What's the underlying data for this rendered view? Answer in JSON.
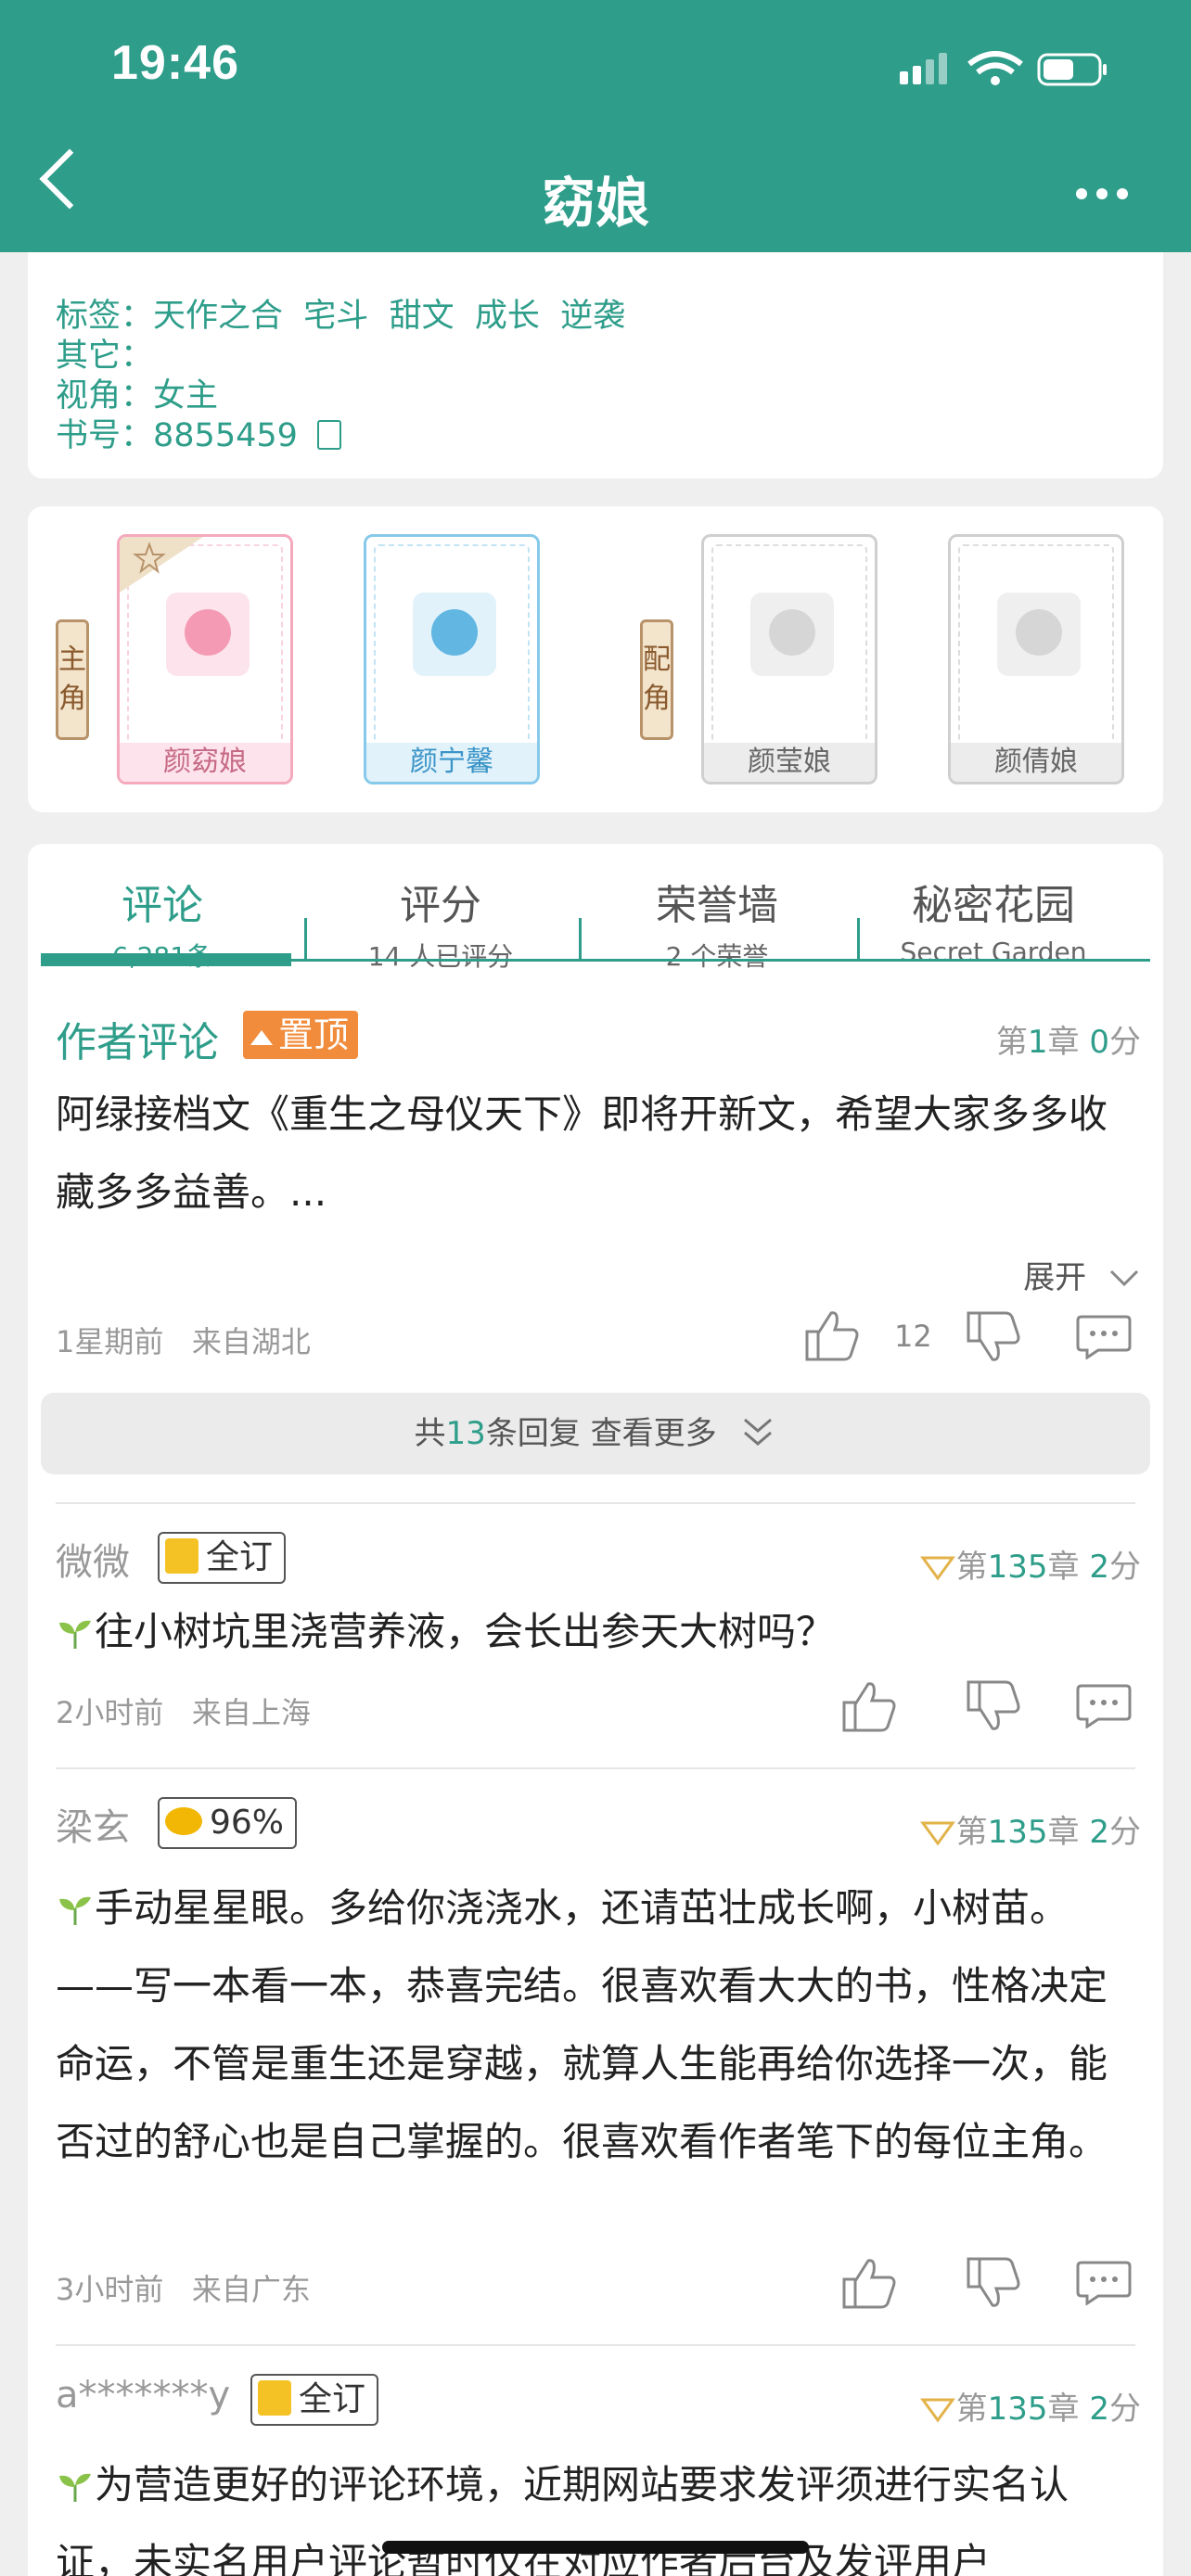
{
  "status_bar": {
    "time": "19:46"
  },
  "nav": {
    "title": "窈娘"
  },
  "info": {
    "tags_label": "标签：",
    "tags": [
      "天作之合",
      "宅斗",
      "甜文",
      "成长",
      "逆袭"
    ],
    "other_label": "其它：",
    "view_label": "视角：",
    "view_value": "女主",
    "book_label": "书号：",
    "book_value": "8855459"
  },
  "characters": {
    "main_label": "主角",
    "support_label": "配角",
    "main": [
      "颜窈娘",
      "颜宁馨"
    ],
    "support": [
      "颜莹娘",
      "颜倩娘"
    ]
  },
  "tabs": [
    {
      "title": "评论",
      "sub": "6,281条"
    },
    {
      "title": "评分",
      "sub": "14 人已评分"
    },
    {
      "title": "荣誉墙",
      "sub": "2 个荣誉"
    },
    {
      "title": "秘密花园",
      "sub": "Secret Garden"
    }
  ],
  "author_comment": {
    "title": "作者评论",
    "pin": "置顶",
    "chapter_prefix": "第",
    "chapter": "1",
    "chapter_suffix": "章",
    "score": "0",
    "score_suffix": "分",
    "body": "阿绿接档文《重生之母仪天下》即将开新文，希望大家多多收藏多多益善。...",
    "expand": "展开",
    "time": "1星期前",
    "location": "来自湖北",
    "likes": "12",
    "replies_prefix": "共",
    "replies_count": "13",
    "replies_suffix": "条回复 查看更多"
  },
  "comments": [
    {
      "user": "微微",
      "badge": "全订",
      "badge_type": "full",
      "chapter": "135",
      "score": "2",
      "body": "往小树坑里浇营养液，会长出参天大树吗？",
      "time": "2小时前",
      "location": "来自上海"
    },
    {
      "user": "梁玄",
      "badge": "96%",
      "badge_type": "gold",
      "chapter": "135",
      "score": "2",
      "body": "手动星星眼。多给你浇浇水，还请茁壮成长啊，小树苗。——写一本看一本，恭喜完结。很喜欢看大大的书，性格决定命运，不管是重生还是穿越，就算人生能再给你选择一次，能否过的舒心也是自己掌握的。很喜欢看作者笔下的每位主角。",
      "time": "3小时前",
      "location": "来自广东"
    },
    {
      "user": "a*******y",
      "badge": "全订",
      "badge_type": "full",
      "chapter": "135",
      "score": "2",
      "body": "为营造更好的评论环境，近期网站要求发评须进行实名认证，未实名用户评论暂时仅在对应作者后台及发评用户",
      "time": "",
      "location": ""
    }
  ],
  "labels": {
    "chapter_prefix": "第",
    "chapter_suffix": "章",
    "score_suffix": "分"
  },
  "colors": {
    "primary": "#2e9d8a",
    "pin": "#f08c3c",
    "background": "#efefef"
  }
}
